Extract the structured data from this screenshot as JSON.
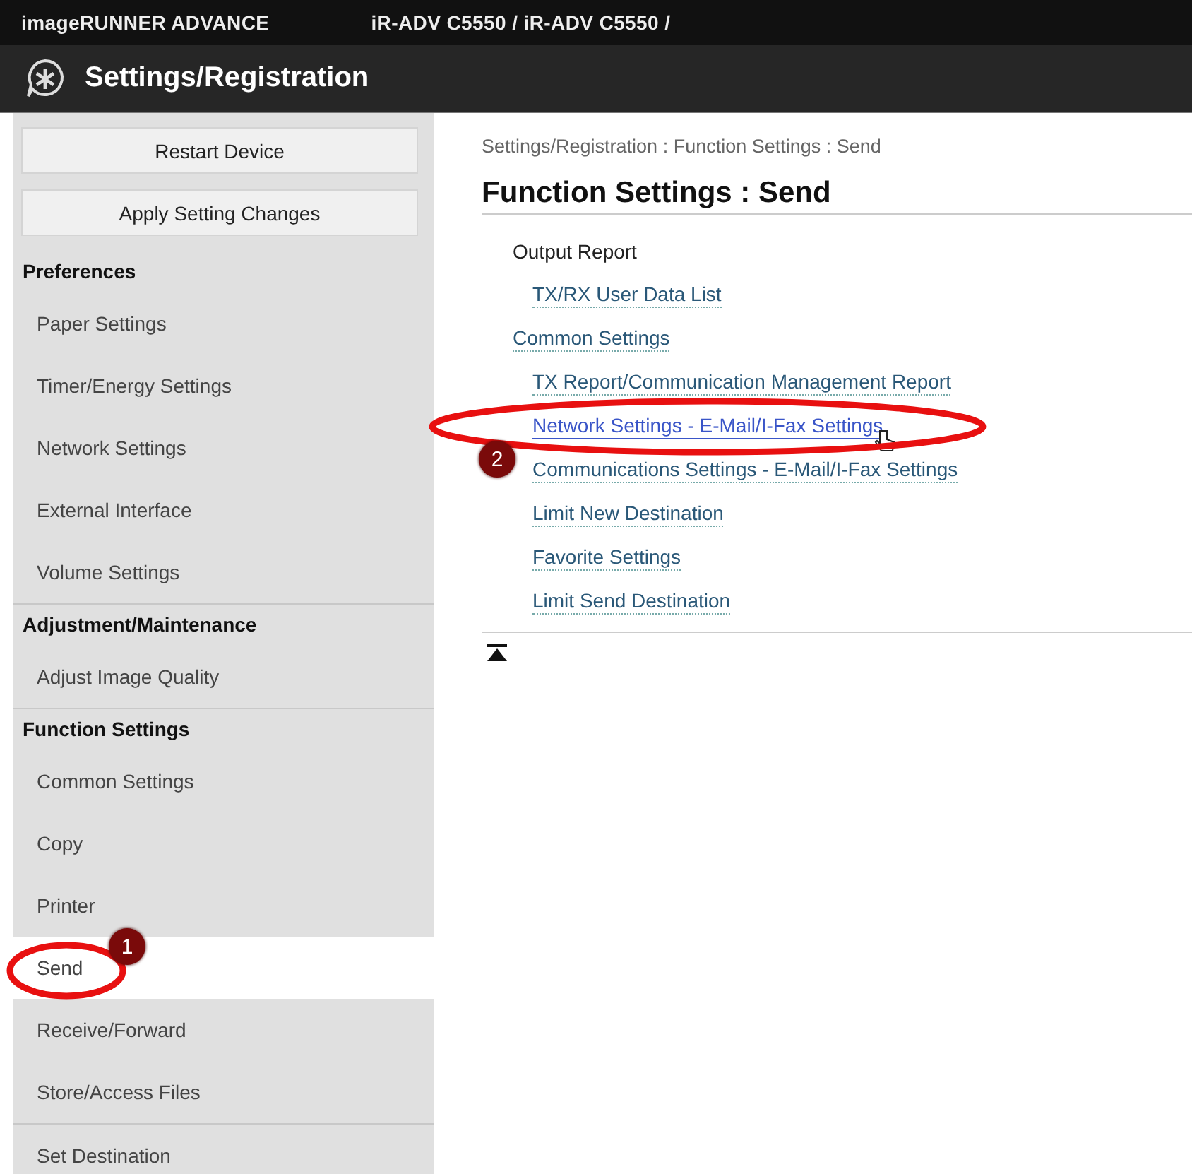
{
  "top_bar": {
    "product": "imageRUNNER ADVANCE",
    "device": "iR-ADV C5550 / iR-ADV C5550 /"
  },
  "header": {
    "title": "Settings/Registration"
  },
  "sidebar": {
    "buttons": [
      "Restart Device",
      "Apply Setting Changes"
    ],
    "sections": [
      {
        "heading": "Preferences",
        "items": [
          {
            "label": "Paper Settings",
            "selected": false
          },
          {
            "label": "Timer/Energy Settings",
            "selected": false
          },
          {
            "label": "Network Settings",
            "selected": false
          },
          {
            "label": "External Interface",
            "selected": false
          },
          {
            "label": "Volume Settings",
            "selected": false
          }
        ]
      },
      {
        "heading": "Adjustment/Maintenance",
        "items": [
          {
            "label": "Adjust Image Quality",
            "selected": false
          }
        ]
      },
      {
        "heading": "Function Settings",
        "items": [
          {
            "label": "Common Settings",
            "selected": false
          },
          {
            "label": "Copy",
            "selected": false
          },
          {
            "label": "Printer",
            "selected": false
          },
          {
            "label": "Send",
            "selected": true,
            "callout": "1"
          },
          {
            "label": "Receive/Forward",
            "selected": false
          },
          {
            "label": "Store/Access Files",
            "selected": false
          }
        ]
      },
      {
        "items": [
          {
            "label": "Set Destination",
            "selected": false
          }
        ]
      }
    ]
  },
  "main": {
    "breadcrumb": "Settings/Registration : Function Settings : Send",
    "title": "Function Settings : Send",
    "entries": [
      {
        "kind": "label",
        "label": "Output Report",
        "children": [
          {
            "kind": "link",
            "label": "TX/RX User Data List",
            "hovered": false
          }
        ]
      },
      {
        "kind": "link",
        "label": "Common Settings",
        "hovered": false,
        "children": [
          {
            "kind": "link",
            "label": "TX Report/Communication Management Report",
            "hovered": false
          },
          {
            "kind": "link",
            "label": "Network Settings - E-Mail/I-Fax Settings",
            "hovered": true,
            "callout": "2"
          },
          {
            "kind": "link",
            "label": "Communications Settings - E-Mail/I-Fax Settings",
            "hovered": false
          },
          {
            "kind": "link",
            "label": "Limit New Destination",
            "hovered": false
          },
          {
            "kind": "link",
            "label": "Favorite Settings",
            "hovered": false
          },
          {
            "kind": "link",
            "label": "Limit Send Destination",
            "hovered": false
          }
        ]
      }
    ]
  }
}
